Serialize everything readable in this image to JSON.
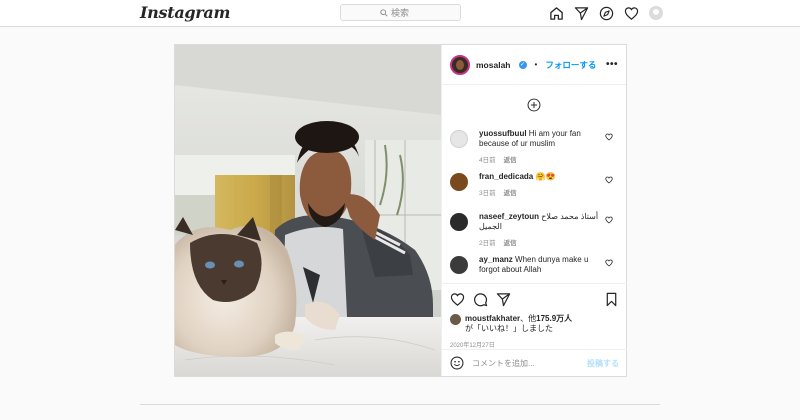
{
  "app": {
    "logo": "Instagram"
  },
  "search": {
    "placeholder": "検索",
    "icon": "search-icon"
  },
  "nav": {
    "icons": [
      "home-icon",
      "direct-icon",
      "explore-icon",
      "activity-heart-icon",
      "profile-avatar"
    ]
  },
  "post": {
    "author": "mosalah",
    "follow_label": "フォローする",
    "dot": "•",
    "more": "•••",
    "comments": [
      {
        "user": "yuossufbuul",
        "text": "Hi am your fan because of ur muslim",
        "time": "4日前",
        "reply": "返信",
        "avatar_color": "#e6e6e6"
      },
      {
        "user": "fran_dedicada",
        "text": "🤗😍",
        "time": "3日前",
        "reply": "返信",
        "avatar_color": "#7a4a1e"
      },
      {
        "user": "naseef_zeytoun",
        "text": "أستاذ محمد صلاح الجميل",
        "time": "2日前",
        "reply": "返信",
        "avatar_color": "#2b2b2b"
      },
      {
        "user": "ay_manz",
        "text": "When dunya make u forgot about Allah",
        "time": "",
        "reply": "",
        "avatar_color": "#3b3b3b"
      }
    ],
    "likes": {
      "user": "moustfakhater",
      "text_mid": "、他",
      "count": "175.9万人",
      "line2": "が「いいね！」しました"
    },
    "date": "2020年12月27日",
    "add_comment_placeholder": "コメントを追加...",
    "post_button": "投稿する"
  },
  "colors": {
    "accent": "#0095f6",
    "verified": "#3897f0",
    "border": "#dbdbdb",
    "muted": "#8e8e8e"
  }
}
